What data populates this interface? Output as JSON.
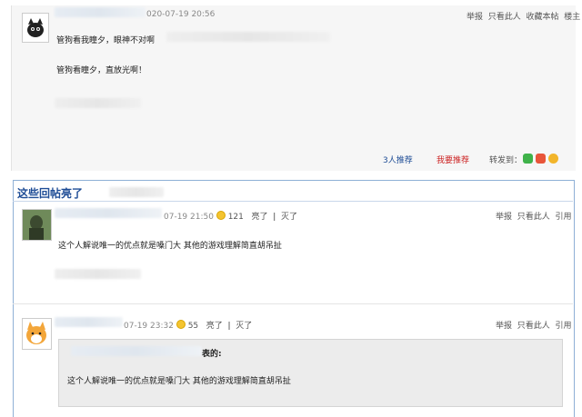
{
  "main_post": {
    "time_suffix": "020-07-19 20:56",
    "actions": [
      "举报",
      "只看此人",
      "收藏本帖",
      "楼主"
    ],
    "content_line1": "管狗看我瞳夕，眼神不对啊",
    "content_line2": "管狗看瞳夕，直放光啊！",
    "recommend_count": "3人推荐",
    "recommend_me": "我要推荐",
    "share_label": "转发到："
  },
  "hot_section": {
    "title": "这些回帖亮了",
    "replies": [
      {
        "time_suffix": "07-19 21:50",
        "likes": "121",
        "light_label": "亮了",
        "light_label2": "灭了",
        "actions": [
          "举报",
          "只看此人",
          "引用"
        ],
        "content": "这个人解说唯一的优点就是嗓门大 其他的游戏理解简直胡吊扯"
      },
      {
        "time_suffix": "07-19 23:32",
        "likes": "55",
        "light_label": "亮了",
        "light_label2": "灭了",
        "actions": [
          "举报",
          "只看此人",
          "引用"
        ],
        "quote_header_suffix": "表的:",
        "quote_content": "这个人解说唯一的优点就是嗓门大 其他的游戏理解简直胡吊扯"
      }
    ]
  },
  "colors": {
    "section_title": "#1f4d96",
    "recommend_count": "#1f4d96",
    "recommend_me": "#cc2222",
    "hot_border": "#8fb0d6"
  },
  "icons": [
    "cat-avatar-icon",
    "green-avatar-icon",
    "shiba-avatar-icon",
    "bulb-icon",
    "wechat-icon",
    "weibo-icon",
    "qzone-icon"
  ]
}
